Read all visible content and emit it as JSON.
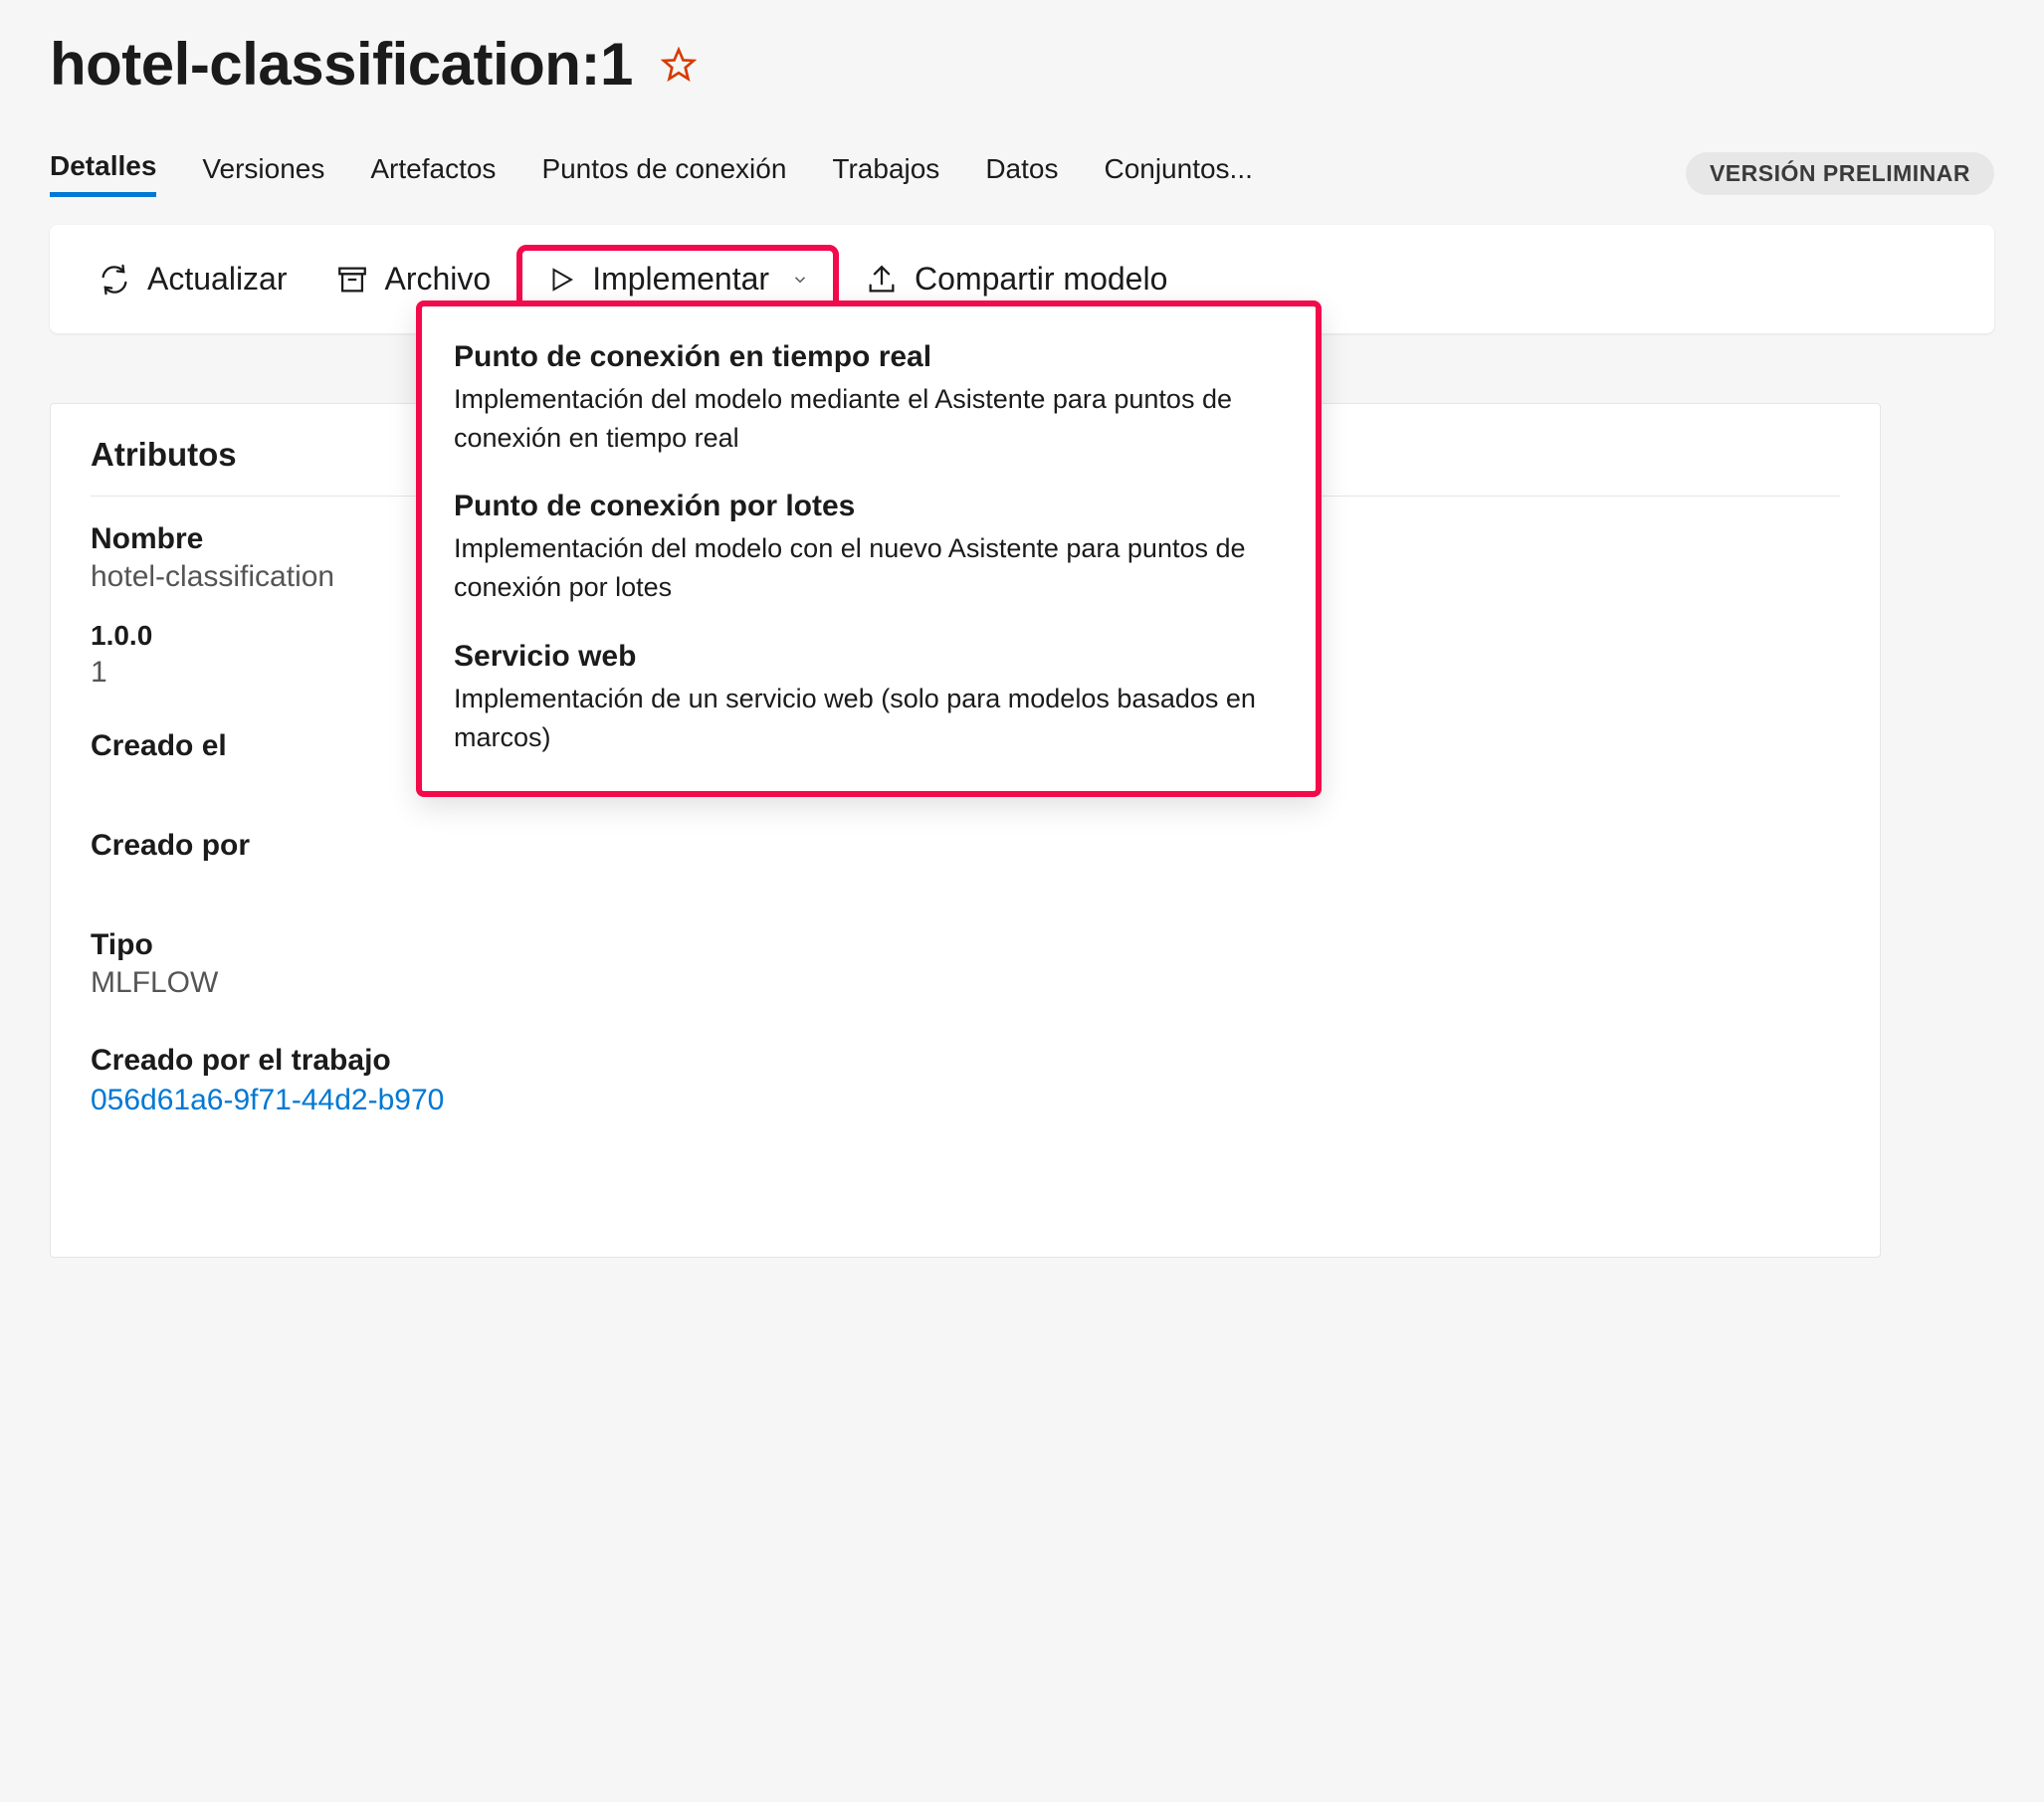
{
  "header": {
    "title": "hotel-classification:1"
  },
  "tabs": {
    "items": [
      {
        "label": "Detalles",
        "active": true
      },
      {
        "label": "Versiones"
      },
      {
        "label": "Artefactos"
      },
      {
        "label": "Puntos de conexión"
      },
      {
        "label": "Trabajos"
      },
      {
        "label": "Datos"
      },
      {
        "label": "Conjuntos..."
      }
    ],
    "preview_badge": "VERSIÓN PRELIMINAR"
  },
  "toolbar": {
    "refresh_label": "Actualizar",
    "archive_label": "Archivo",
    "deploy_label": "Implementar",
    "share_label": "Compartir modelo"
  },
  "deploy_menu": {
    "items": [
      {
        "title": "Punto de conexión en tiempo real",
        "desc": "Implementación del modelo mediante el Asistente para puntos de conexión en tiempo real"
      },
      {
        "title": "Punto de conexión por lotes",
        "desc": "Implementación del modelo con el nuevo Asistente para puntos de conexión por lotes"
      },
      {
        "title": "Servicio web",
        "desc": "Implementación de un servicio web (solo para modelos basados en marcos)"
      }
    ]
  },
  "attributes": {
    "section_title": "Atributos",
    "name_label": "Nombre",
    "name_value": "hotel-classification",
    "version_label": "1.0.0",
    "version_value": "1",
    "created_on_label": "Creado el",
    "created_by_label": "Creado por",
    "type_label": "Tipo",
    "type_value": "MLFLOW",
    "created_by_job_label": "Creado por el trabajo",
    "created_by_job_value": "056d61a6-9f71-44d2-b970"
  }
}
